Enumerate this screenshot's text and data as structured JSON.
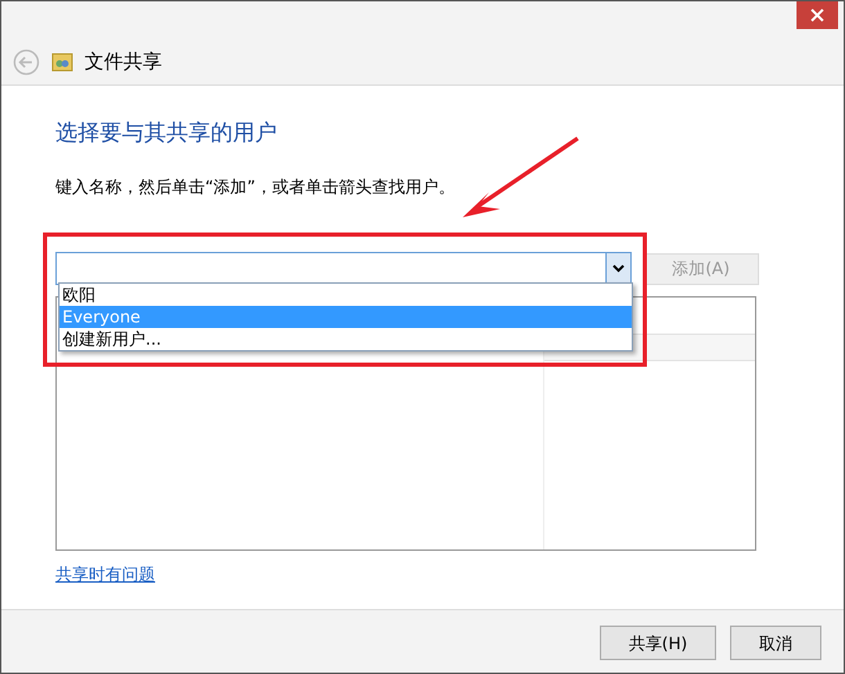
{
  "window": {
    "title": "文件共享"
  },
  "heading": "选择要与其共享的用户",
  "instruction": "键入名称，然后单击“添加”，或者单击箭头查找用户。",
  "name_combo": {
    "expanded": true,
    "options": [
      {
        "label": "欧阳",
        "selected": false
      },
      {
        "label": "Everyone",
        "selected": true
      },
      {
        "label": "创建新用户...",
        "selected": false
      }
    ]
  },
  "add_button": {
    "label": "添加(A)",
    "disabled": true
  },
  "help_link": "共享时有问题",
  "buttons": [
    {
      "label": "共享(H)"
    },
    {
      "label": "取消"
    }
  ]
}
